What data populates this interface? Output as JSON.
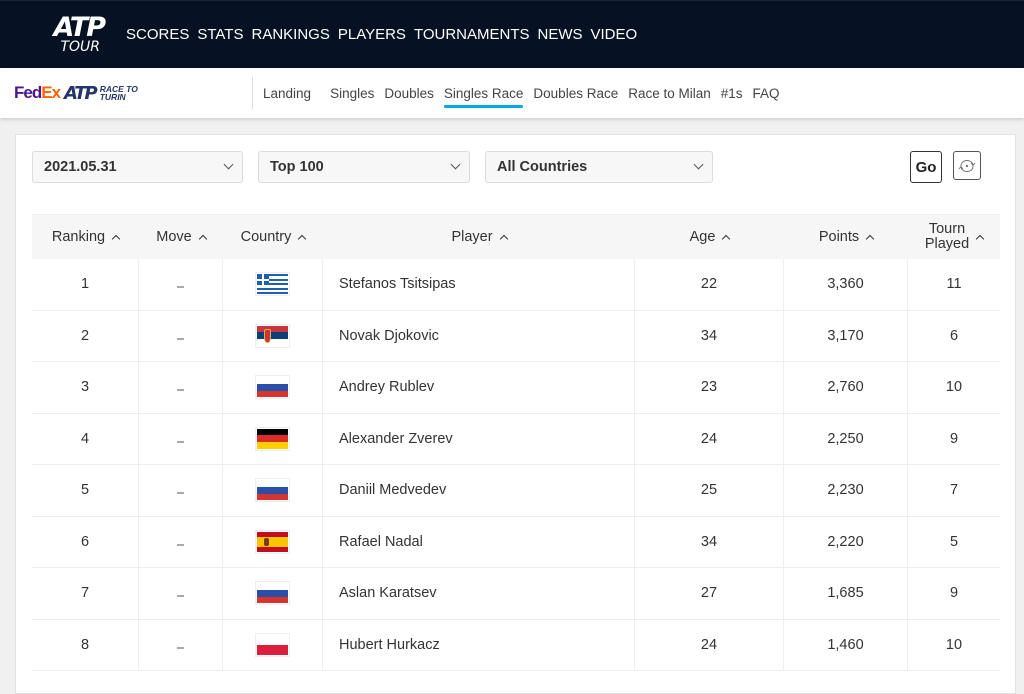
{
  "header": {
    "logo_top": "ATP",
    "logo_bottom": "TOUR",
    "nav": [
      "SCORES",
      "STATS",
      "RANKINGS",
      "PLAYERS",
      "TOURNAMENTS",
      "NEWS",
      "VIDEO"
    ]
  },
  "subheader": {
    "logo_fedex_1": "Fed",
    "logo_fedex_2": "Ex",
    "logo_atp": "ATP",
    "logo_race_1": "RACE TO",
    "logo_race_2": "TURIN",
    "nav": [
      {
        "label": "Landing",
        "active": false
      },
      {
        "label": "Singles",
        "active": false
      },
      {
        "label": "Doubles",
        "active": false
      },
      {
        "label": "Singles Race",
        "active": true
      },
      {
        "label": "Doubles Race",
        "active": false
      },
      {
        "label": "Race to Milan",
        "active": false
      },
      {
        "label": "#1s",
        "active": false
      },
      {
        "label": "FAQ",
        "active": false
      }
    ],
    "accent_color": "#00a8e6"
  },
  "filters": {
    "date": "2021.05.31",
    "range": "Top 100",
    "country": "All Countries",
    "go_label": "Go",
    "reset_icon": "refresh-icon"
  },
  "table": {
    "columns": [
      "Ranking",
      "Move",
      "Country",
      "Player",
      "Age",
      "Points",
      "Tourn",
      "Played"
    ],
    "rows": [
      {
        "rank": "1",
        "move": "–",
        "country": "GRE",
        "player": "Stefanos Tsitsipas",
        "age": "22",
        "points": "3,360",
        "tourn": "11"
      },
      {
        "rank": "2",
        "move": "–",
        "country": "SRB",
        "player": "Novak Djokovic",
        "age": "34",
        "points": "3,170",
        "tourn": "6"
      },
      {
        "rank": "3",
        "move": "–",
        "country": "RUS",
        "player": "Andrey Rublev",
        "age": "23",
        "points": "2,760",
        "tourn": "10"
      },
      {
        "rank": "4",
        "move": "–",
        "country": "GER",
        "player": "Alexander Zverev",
        "age": "24",
        "points": "2,250",
        "tourn": "9"
      },
      {
        "rank": "5",
        "move": "–",
        "country": "RUS",
        "player": "Daniil Medvedev",
        "age": "25",
        "points": "2,230",
        "tourn": "7"
      },
      {
        "rank": "6",
        "move": "–",
        "country": "ESP",
        "player": "Rafael Nadal",
        "age": "34",
        "points": "2,220",
        "tourn": "5"
      },
      {
        "rank": "7",
        "move": "–",
        "country": "RUS",
        "player": "Aslan Karatsev",
        "age": "27",
        "points": "1,685",
        "tourn": "9"
      },
      {
        "rank": "8",
        "move": "–",
        "country": "POL",
        "player": "Hubert Hurkacz",
        "age": "24",
        "points": "1,460",
        "tourn": "10"
      }
    ]
  }
}
